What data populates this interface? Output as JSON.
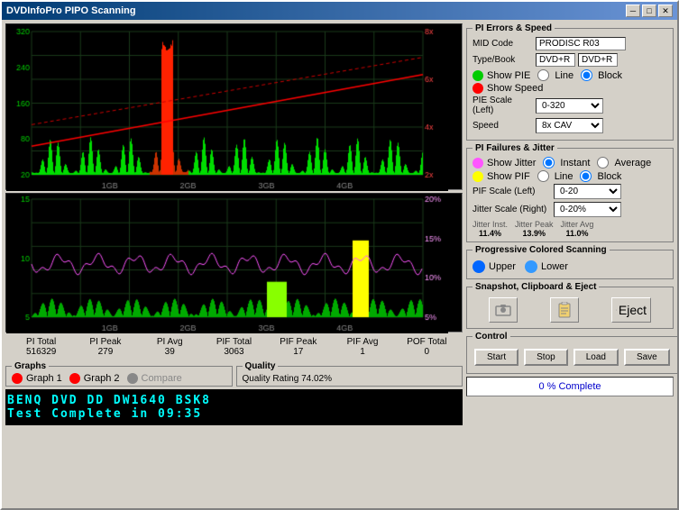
{
  "window": {
    "title": "DVDInfoPro PIPO Scanning"
  },
  "titlebar": {
    "minimize": "─",
    "maximize": "□",
    "close": "✕"
  },
  "pi_errors": {
    "section_title": "PI Errors & Speed",
    "mid_code_label": "MID Code",
    "mid_code_value": "PRODISC R03",
    "type_book_label": "Type/Book",
    "type1": "DVD+R",
    "type2": "DVD+R",
    "show_pie_label": "Show PIE",
    "show_pie_line": "Line",
    "show_pie_block": "Block",
    "show_speed_label": "Show Speed",
    "pie_scale_label": "PIE Scale (Left)",
    "pie_scale_value": "0-320",
    "speed_label": "Speed",
    "speed_value": "8x CAV"
  },
  "pi_failures": {
    "section_title": "PI Failures & Jitter",
    "show_jitter_label": "Show Jitter",
    "show_jitter_instant": "Instant",
    "show_jitter_average": "Average",
    "show_pif_label": "Show PIF",
    "show_pif_line": "Line",
    "show_pif_block": "Block",
    "pif_scale_label": "PIF Scale (Left)",
    "pif_scale_value": "0-20",
    "jitter_scale_label": "Jitter Scale (Right)",
    "jitter_scale_value": "0-20%",
    "jitter_inst_label": "Jitter Inst.",
    "jitter_inst_value": "11.4%",
    "jitter_peak_label": "Jitter Peak",
    "jitter_peak_value": "13.9%",
    "jitter_avg_label": "Jitter Avg",
    "jitter_avg_value": "11.0%"
  },
  "progressive": {
    "section_title": "Progressive Colored Scanning",
    "upper_label": "Upper",
    "lower_label": "Lower"
  },
  "snapshot": {
    "section_title": "Snapshot, Clipboard  & Eject",
    "eject_label": "Eject"
  },
  "control": {
    "section_title": "Control",
    "start_label": "Start",
    "stop_label": "Stop",
    "load_label": "Load",
    "save_label": "Save"
  },
  "progress": {
    "value": "0 % Complete"
  },
  "totals": {
    "labels": [
      "PI Total",
      "PI Peak",
      "PI Avg",
      "PIF Total",
      "PIF Peak",
      "PIF Avg",
      "POF Total"
    ],
    "values": [
      "516329",
      "279",
      "39",
      "3063",
      "17",
      "1",
      "0"
    ]
  },
  "graphs": {
    "section_title": "Graphs",
    "graph1_label": "Graph 1",
    "graph2_label": "Graph 2",
    "compare_label": "Compare"
  },
  "quality": {
    "section_title": "Quality",
    "rating": "Quality Rating 74.02%"
  },
  "marquee": {
    "line1": "BENQ     DVD DD DW1640 BSK8",
    "line2": "Test Complete in 09:35"
  },
  "chart_top": {
    "y_labels_left": [
      "320",
      "240",
      "160",
      "80",
      "20"
    ],
    "y_labels_right": [
      "8x",
      "6x",
      "4x",
      "2x"
    ],
    "x_labels": [
      "1GB",
      "2GB",
      "3GB",
      "4GB"
    ]
  },
  "chart_bottom": {
    "y_labels_left": [
      "15",
      "10",
      "5"
    ],
    "y_labels_right": [
      "20%",
      "15%",
      "10%",
      "5%"
    ],
    "x_labels": [
      "1GB",
      "2GB",
      "3GB",
      "4GB"
    ]
  }
}
